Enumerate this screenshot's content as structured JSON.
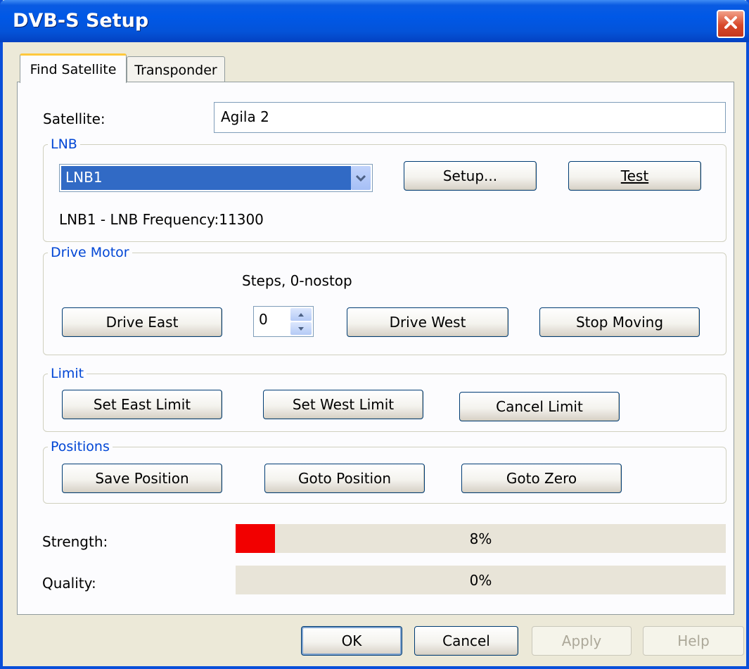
{
  "window": {
    "title": "DVB-S Setup",
    "close_icon": "close-icon"
  },
  "tabs": [
    {
      "label": "Find Satellite",
      "active": true
    },
    {
      "label": "Transponder",
      "active": false
    }
  ],
  "satellite": {
    "label": "Satellite:",
    "value": "Agila 2"
  },
  "lnb": {
    "legend": "LNB",
    "selected": "LNB1",
    "setup_label": "Setup...",
    "test_label": "Test",
    "info": "LNB1 - LNB Frequency:11300"
  },
  "drive_motor": {
    "legend": "Drive Motor",
    "steps_label": "Steps, 0-nostop",
    "steps_value": "0",
    "drive_east": "Drive East",
    "drive_west": "Drive West",
    "stop_moving": "Stop Moving"
  },
  "limit": {
    "legend": "Limit",
    "set_east": "Set East Limit",
    "set_west": "Set West Limit",
    "cancel": "Cancel Limit"
  },
  "positions": {
    "legend": "Positions",
    "save": "Save Position",
    "goto": "Goto Position",
    "goto_zero": "Goto Zero"
  },
  "signal": {
    "strength_label": "Strength:",
    "strength_value": 8,
    "strength_text": "8%",
    "strength_color": "#F20000",
    "quality_label": "Quality:",
    "quality_value": 0,
    "quality_text": "0%"
  },
  "footer": {
    "ok": "OK",
    "cancel": "Cancel",
    "apply": "Apply",
    "help": "Help"
  }
}
